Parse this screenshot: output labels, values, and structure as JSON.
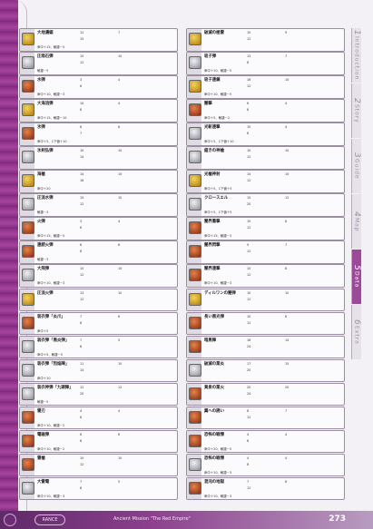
{
  "left_cards": [
    {
      "name": "大地濃鋸",
      "s1": "12",
      "s2": "7",
      "s3": "15",
      "extra": "命中＋15、敏捷－5",
      "color": "gold"
    },
    {
      "name": "圧雨石弾",
      "s1": "15",
      "s2": "10",
      "s3": "12",
      "extra": "敏捷－5",
      "color": "gray"
    },
    {
      "name": "水弾",
      "s1": "3",
      "s2": "4",
      "s3": "6",
      "extra": "命中＋10、敏捷－3",
      "color": "red"
    },
    {
      "name": "大海流弾",
      "s1": "10",
      "s2": "4",
      "s3": "8",
      "extra": "命中＋15、敏捷－10",
      "color": "gold"
    },
    {
      "name": "氷弾",
      "s1": "6",
      "s2": "6",
      "s3": "7",
      "extra": "命中＋5、C下値＋10",
      "color": "red"
    },
    {
      "name": "氷剣弘弾",
      "s1": "10",
      "s2": "10",
      "s3": "14",
      "extra": "",
      "color": "gray"
    },
    {
      "name": "海槍",
      "s1": "14",
      "s2": "10",
      "s3": "16",
      "extra": "命中＋20",
      "color": "gold"
    },
    {
      "name": "圧流水弾",
      "s1": "15",
      "s2": "10",
      "s3": "12",
      "extra": "敏捷－3",
      "color": "gray"
    },
    {
      "name": "火弾",
      "s1": "3",
      "s2": "4",
      "s3": "6",
      "extra": "命中＋15、敏捷－5",
      "color": "red"
    },
    {
      "name": "連続火弾",
      "s1": "6",
      "s2": "6",
      "s3": "8",
      "extra": "敏捷－3",
      "color": "red"
    },
    {
      "name": "大飛弾",
      "s1": "10",
      "s2": "10",
      "s3": "12",
      "extra": "命中＋10、敏捷－3",
      "color": "gray"
    },
    {
      "name": "圧流火弾",
      "s1": "13",
      "s2": "10",
      "s3": "12",
      "extra": "",
      "color": "gold"
    },
    {
      "name": "装衣弾「炎爪」",
      "s1": "7",
      "s2": "6",
      "s3": "8",
      "extra": "命中＋5",
      "color": "red"
    },
    {
      "name": "装衣弾「黒炎弾」",
      "s1": "7",
      "s2": "5",
      "s3": "8",
      "extra": "命中＋5、敏捷－5",
      "color": "gray"
    },
    {
      "name": "装衣弾「烈焔陣」",
      "s1": "11",
      "s2": "10",
      "s3": "14",
      "extra": "命中＋10",
      "color": "gray"
    },
    {
      "name": "装衣神弾「九頭陣」",
      "s1": "12",
      "s2": "12",
      "s3": "20",
      "extra": "敏捷－5",
      "color": "gray"
    },
    {
      "name": "雷刃",
      "s1": "4",
      "s2": "4",
      "s3": "6",
      "extra": "命中＋10、敏捷－2",
      "color": "red"
    },
    {
      "name": "電磁弾",
      "s1": "6",
      "s2": "6",
      "s3": "8",
      "extra": "命中＋10、敏捷－2",
      "color": "red"
    },
    {
      "name": "雷槍",
      "s1": "10",
      "s2": "10",
      "s3": "12",
      "extra": "",
      "color": "red"
    },
    {
      "name": "大雷電",
      "s1": "7",
      "s2": "5",
      "s3": "8",
      "extra": "命中＋10、敏捷－3",
      "color": "gray"
    }
  ],
  "right_cards": [
    {
      "name": "破滅の極雷",
      "s1": "10",
      "s2": "9",
      "s3": "12",
      "extra": "",
      "color": "gold"
    },
    {
      "name": "吸子弾",
      "s1": "13",
      "s2": "7",
      "s3": "8",
      "extra": "命中＋10、敏捷－5",
      "color": "gray"
    },
    {
      "name": "吸子連鎖",
      "s1": "16",
      "s2": "10",
      "s3": "12",
      "extra": "命中＋10、敏捷－5",
      "color": "gold"
    },
    {
      "name": "闇撃",
      "s1": "6",
      "s2": "4",
      "s3": "8",
      "extra": "命中＋5、敏捷－2",
      "color": "red"
    },
    {
      "name": "光斬連撃",
      "s1": "10",
      "s2": "4",
      "s3": "8",
      "extra": "命中＋5、C下値＋10",
      "color": "gray"
    },
    {
      "name": "鎧きの神槍",
      "s1": "10",
      "s2": "10",
      "s3": "12",
      "extra": "",
      "color": "gray"
    },
    {
      "name": "光槍神射",
      "s1": "14",
      "s2": "10",
      "s3": "12",
      "extra": "命中＋5、C下値＋5",
      "color": "gold"
    },
    {
      "name": "クロースエル",
      "s1": "15",
      "s2": "12",
      "s3": "20",
      "extra": "命中＋5、C下値＋5",
      "color": "gray"
    },
    {
      "name": "闇界重撃",
      "s1": "10",
      "s2": "8",
      "s3": "12",
      "extra": "命中＋15、敏捷－3",
      "color": "red"
    },
    {
      "name": "闇界閃撃",
      "s1": "9",
      "s2": "7",
      "s3": "12",
      "extra": "",
      "color": "red"
    },
    {
      "name": "闇界連撃",
      "s1": "10",
      "s2": "8",
      "s3": "12",
      "extra": "命中＋10、敏捷－3",
      "color": "red"
    },
    {
      "name": "ディルワンの闇弾",
      "s1": "10",
      "s2": "10",
      "s3": "12",
      "extra": "",
      "color": "gold"
    },
    {
      "name": "長い黒光弾",
      "s1": "10",
      "s2": "8",
      "s3": "12",
      "extra": "",
      "color": "red"
    },
    {
      "name": "暗黒陣",
      "s1": "16",
      "s2": "14",
      "s3": "24",
      "extra": "",
      "color": "red"
    },
    {
      "name": "破滅の業炎",
      "s1": "17",
      "s2": "15",
      "s3": "20",
      "extra": "",
      "color": "gray"
    },
    {
      "name": "黄泉の業火",
      "s1": "20",
      "s2": "20",
      "s3": "24",
      "extra": "",
      "color": "red"
    },
    {
      "name": "翼への誘い",
      "s1": "8",
      "s2": "7",
      "s3": "12",
      "extra": "",
      "color": "red"
    },
    {
      "name": "恐怖の戦慄",
      "s1": "4",
      "s2": "4",
      "s3": "8",
      "extra": "命中＋20、敏捷－5",
      "color": "red"
    },
    {
      "name": "恐怖の戦慄",
      "s1": "4",
      "s2": "4",
      "s3": "8",
      "extra": "命中＋10、敏捷－3",
      "color": "gray"
    },
    {
      "name": "混沌の地獄",
      "s1": "7",
      "s2": "8",
      "s3": "12",
      "extra": "命中＋10、敏捷－3",
      "color": "red"
    }
  ],
  "tabs": [
    {
      "num": "1",
      "label": "Introduction"
    },
    {
      "num": "2",
      "label": "Story"
    },
    {
      "num": "3",
      "label": "Guide"
    },
    {
      "num": "4",
      "label": "Map"
    },
    {
      "num": "5",
      "label": "Data"
    },
    {
      "num": "6",
      "label": "Extra"
    }
  ],
  "footer": {
    "logo": "RANCE",
    "title": "Ancient Mission \"The Red Empire\"",
    "page": "273"
  }
}
